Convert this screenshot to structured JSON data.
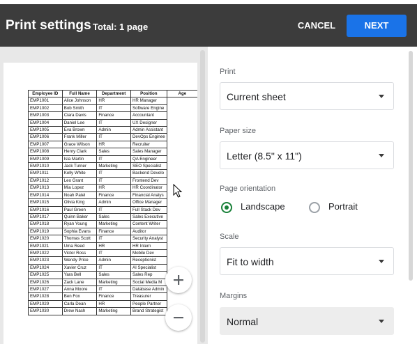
{
  "header": {
    "title": "Print settings",
    "total": "Total: 1 page",
    "cancel_label": "CANCEL",
    "next_label": "NEXT"
  },
  "colors": {
    "header_bg": "#3c3c3c",
    "accent_blue": "#1a73e8",
    "radio_green": "#188038"
  },
  "preview": {
    "columns": [
      "Employee ID",
      "Full Name",
      "Department",
      "Position",
      "Age"
    ],
    "rows": [
      [
        "EMP1001",
        "Alice Johnson",
        "HR",
        "HR Manager"
      ],
      [
        "EMP1002",
        "Bob Smith",
        "IT",
        "Software Engine"
      ],
      [
        "EMP1003",
        "Ciara Davis",
        "Finance",
        "Accountant"
      ],
      [
        "EMP1004",
        "Daniel Lee",
        "IT",
        "UX Designer"
      ],
      [
        "EMP1005",
        "Eva Brown",
        "Admin",
        "Admin Assistant"
      ],
      [
        "EMP1006",
        "Frank Miller",
        "IT",
        "DevOps Enginee"
      ],
      [
        "EMP1007",
        "Grace Wilson",
        "HR",
        "Recruiter"
      ],
      [
        "EMP1008",
        "Henry Clark",
        "Sales",
        "Sales Manager"
      ],
      [
        "EMP1009",
        "Isla Martin",
        "IT",
        "QA Engineer"
      ],
      [
        "EMP1010",
        "Jack Turner",
        "Marketing",
        "SEO Specialist"
      ],
      [
        "EMP1011",
        "Kelly White",
        "IT",
        "Backend Develo"
      ],
      [
        "EMP1012",
        "Leo Grant",
        "IT",
        "Frontend Dev"
      ],
      [
        "EMP1013",
        "Mia Lopez",
        "HR",
        "HR Coordinator"
      ],
      [
        "EMP1014",
        "Noah Patel",
        "Finance",
        "Financial Analys"
      ],
      [
        "EMP1015",
        "Olivia King",
        "Admin",
        "Office Manager"
      ],
      [
        "EMP1016",
        "Paul Green",
        "IT",
        "Full Stack Dev"
      ],
      [
        "EMP1017",
        "Quinn Baker",
        "Sales",
        "Sales Executive"
      ],
      [
        "EMP1018",
        "Ryan Young",
        "Marketing",
        "Content Writer"
      ],
      [
        "EMP1019",
        "Sophia Evans",
        "Finance",
        "Auditor"
      ],
      [
        "EMP1020",
        "Thomas Scott",
        "IT",
        "Security Analyst"
      ],
      [
        "EMP1021",
        "Uma Reed",
        "HR",
        "HR Intern"
      ],
      [
        "EMP1022",
        "Victor Ross",
        "IT",
        "Mobile Dev"
      ],
      [
        "EMP1023",
        "Wendy Price",
        "Admin",
        "Receptionist"
      ],
      [
        "EMP1024",
        "Xavier Cruz",
        "IT",
        "AI Specialist"
      ],
      [
        "EMP1025",
        "Yara Bell",
        "Sales",
        "Sales Rep"
      ],
      [
        "EMP1026",
        "Zack Lane",
        "Marketing",
        "Social Media M"
      ],
      [
        "EMP1027",
        "Anna Moore",
        "IT",
        "Database Admin"
      ],
      [
        "EMP1028",
        "Ben Fox",
        "Finance",
        "Treasurer"
      ],
      [
        "EMP1029",
        "Carla Dean",
        "HR",
        "People Partner"
      ],
      [
        "EMP1030",
        "Drew Nash",
        "Marketing",
        "Brand Strategist"
      ]
    ],
    "zoom_in_icon": "plus-icon",
    "zoom_out_icon": "minus-icon"
  },
  "settings": {
    "print": {
      "label": "Print",
      "value": "Current sheet"
    },
    "paper_size": {
      "label": "Paper size",
      "value": "Letter (8.5\" x 11\")"
    },
    "orientation": {
      "label": "Page orientation",
      "options": [
        "Landscape",
        "Portrait"
      ],
      "selected": "Landscape"
    },
    "scale": {
      "label": "Scale",
      "value": "Fit to width"
    },
    "margins": {
      "label": "Margins",
      "value": "Normal"
    }
  }
}
